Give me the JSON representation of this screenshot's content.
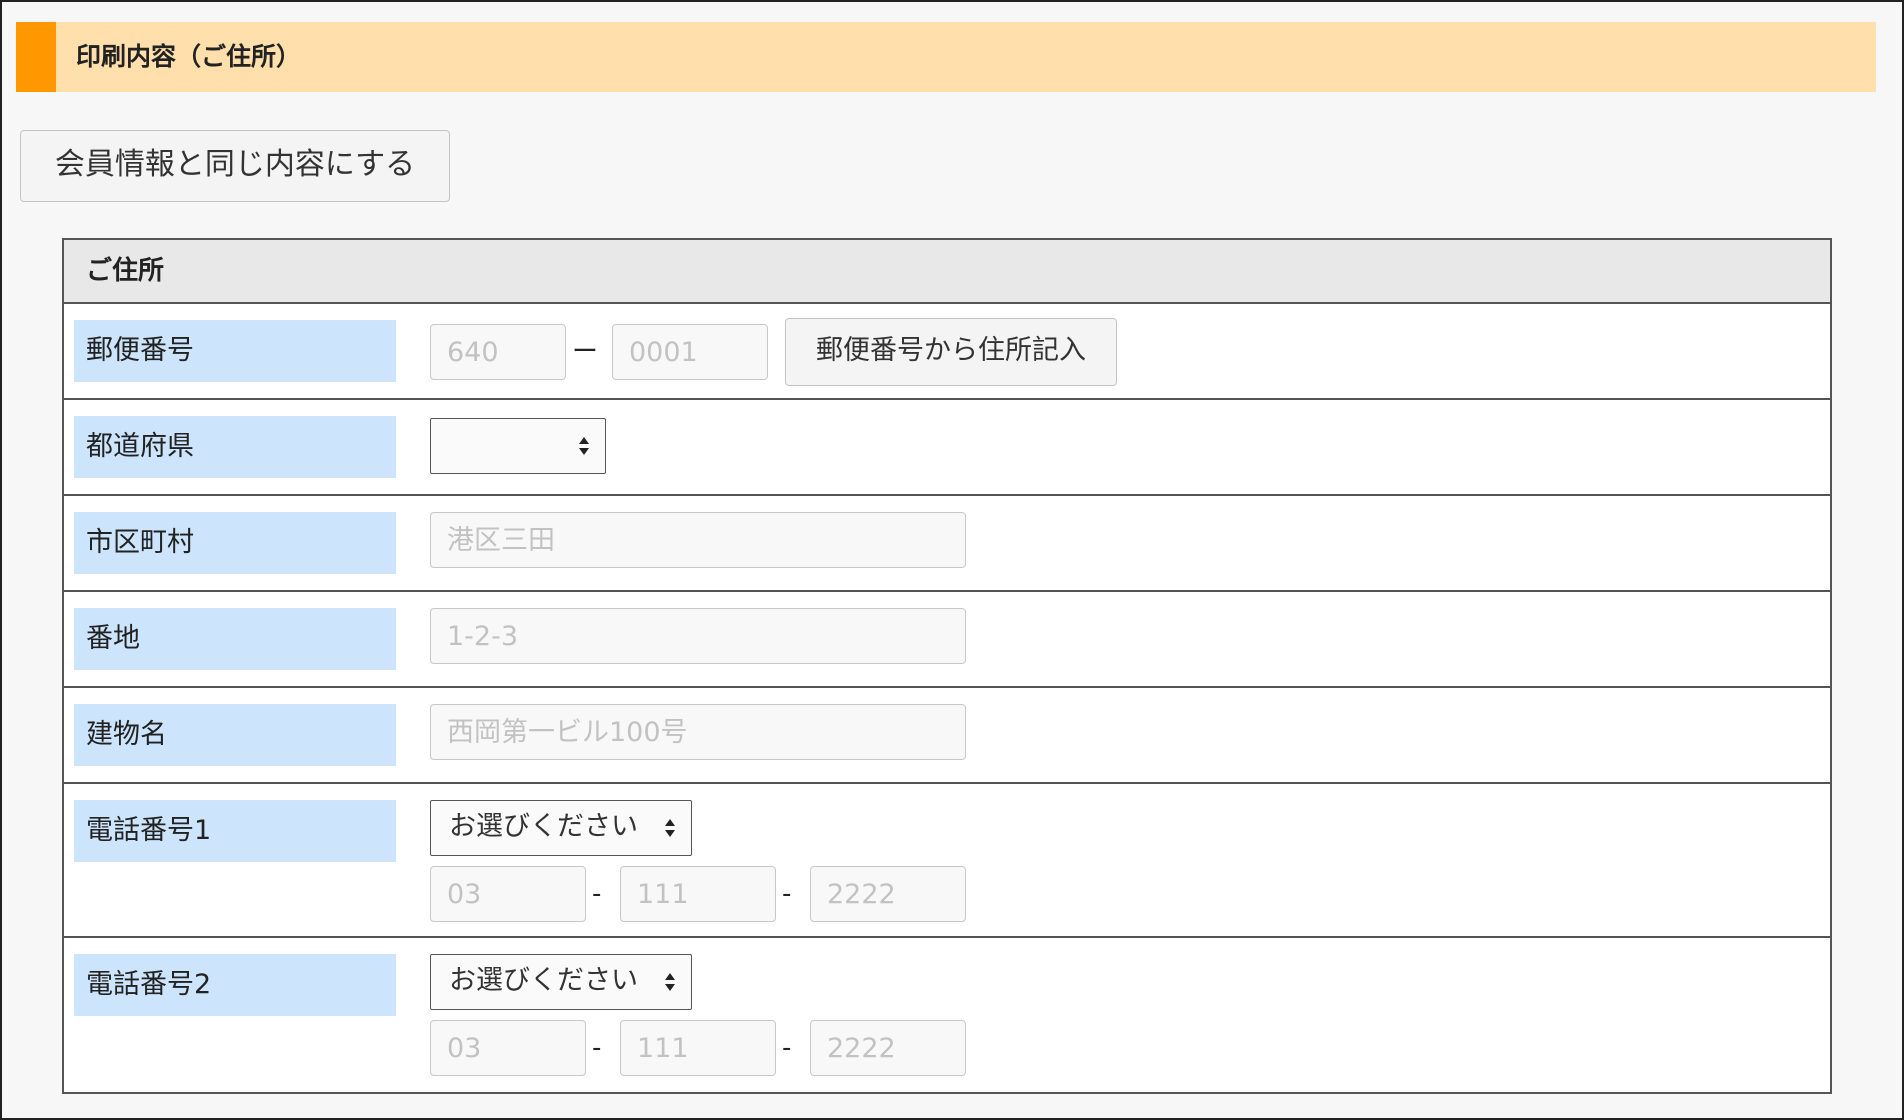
{
  "section": {
    "title": "印刷内容（ご住所）"
  },
  "copy_button": {
    "label": "会員情報と同じ内容にする"
  },
  "address_table": {
    "title": "ご住所"
  },
  "postal": {
    "label": "郵便番号",
    "first_placeholder": "640",
    "separator": "ー",
    "second_placeholder": "0001",
    "lookup_button": "郵便番号から住所記入"
  },
  "prefecture": {
    "label": "都道府県",
    "selected": ""
  },
  "city": {
    "label": "市区町村",
    "placeholder": "港区三田"
  },
  "street": {
    "label": "番地",
    "placeholder": "1-2-3"
  },
  "building": {
    "label": "建物名",
    "placeholder": "西岡第一ビル100号"
  },
  "phone1": {
    "label": "電話番号1",
    "type_selected": "お選びください",
    "part1_placeholder": "03",
    "part2_placeholder": "111",
    "part3_placeholder": "2222",
    "separator": "-"
  },
  "phone2": {
    "label": "電話番号2",
    "type_selected": "お選びください",
    "part1_placeholder": "03",
    "part2_placeholder": "111",
    "part3_placeholder": "2222",
    "separator": "-"
  },
  "colors": {
    "header_bg": "#ffdfab",
    "header_accent": "#ff9800",
    "label_bg": "#cce4fc"
  },
  "icons": {
    "select_arrows": "updown-arrows-icon"
  }
}
